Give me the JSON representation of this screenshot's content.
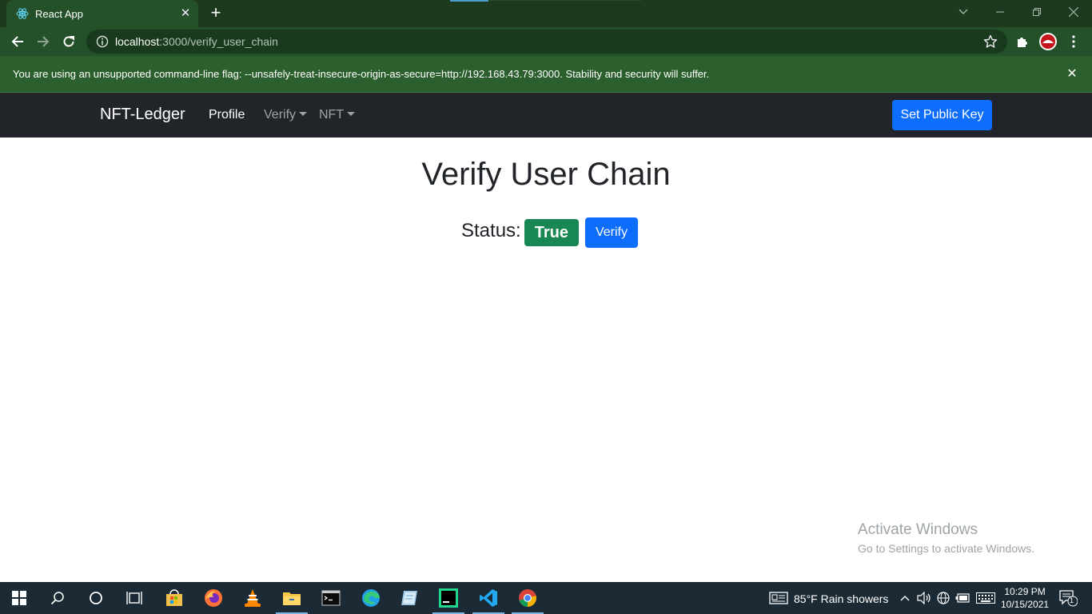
{
  "browser": {
    "tab_title": "React App",
    "url_host": "localhost",
    "url_path": ":3000/verify_user_chain",
    "infobar_message": "You are using an unsupported command-line flag: --unsafely-treat-insecure-origin-as-secure=http://192.168.43.79:3000. Stability and security will suffer."
  },
  "navbar": {
    "brand": "NFT-Ledger",
    "links": [
      "Profile",
      "Verify",
      "NFT"
    ],
    "set_key_label": "Set Public Key"
  },
  "main": {
    "title": "Verify User Chain",
    "status_label": "Status:",
    "status_value": "True",
    "verify_label": "Verify"
  },
  "watermark": {
    "line1": "Activate Windows",
    "line2": "Go to Settings to activate Windows."
  },
  "taskbar": {
    "weather": "85°F  Rain showers",
    "time": "10:29 PM",
    "date": "10/15/2021",
    "notification_count": "1"
  },
  "colors": {
    "brand_primary": "#0d6efd",
    "success": "#198754",
    "navbar_bg": "#212529",
    "chrome_green": "#24502a"
  }
}
